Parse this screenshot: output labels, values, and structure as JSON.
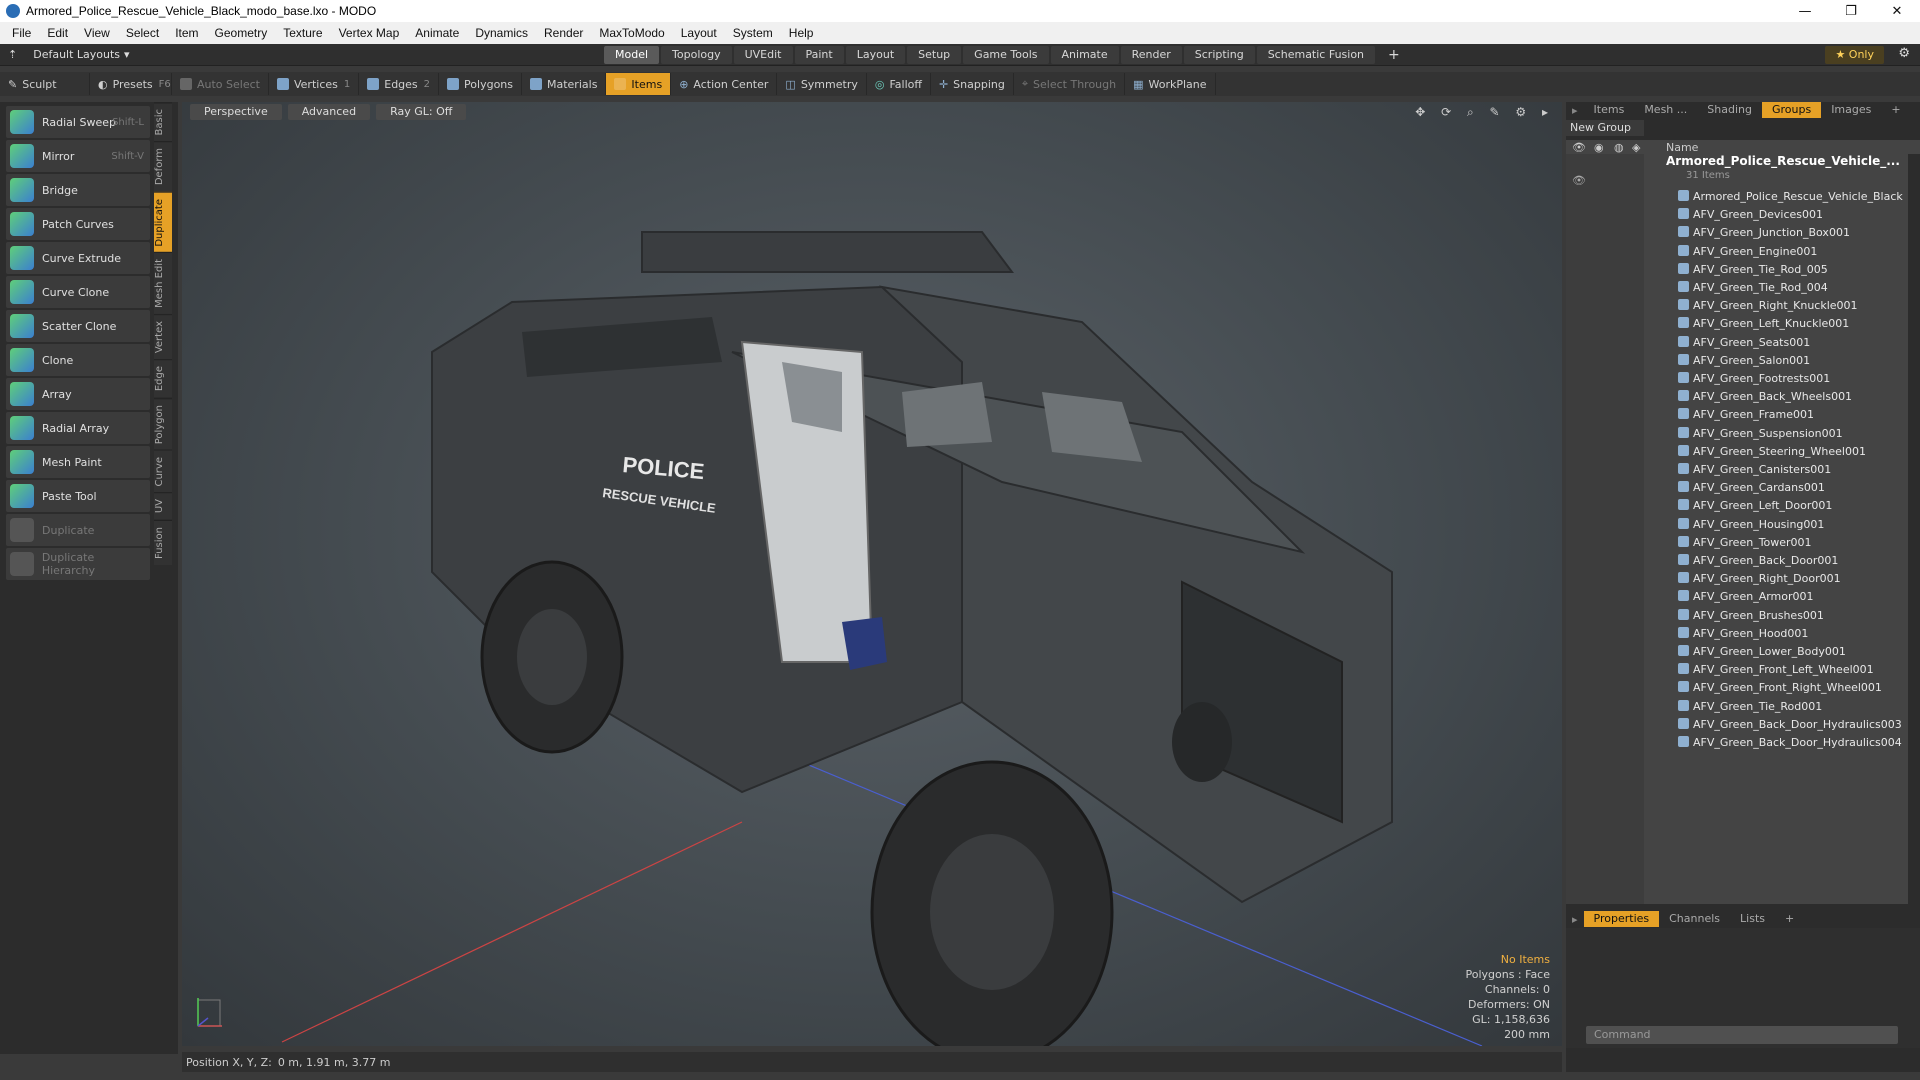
{
  "window": {
    "title": "Armored_Police_Rescue_Vehicle_Black_modo_base.lxo - MODO",
    "min": "—",
    "max": "❐",
    "close": "✕"
  },
  "menubar": [
    "File",
    "Edit",
    "View",
    "Select",
    "Item",
    "Geometry",
    "Texture",
    "Vertex Map",
    "Animate",
    "Dynamics",
    "Render",
    "MaxToModo",
    "Layout",
    "System",
    "Help"
  ],
  "layoutbar": {
    "layouts_label": "Default Layouts",
    "tabs": [
      "Model",
      "Topology",
      "UVEdit",
      "Paint",
      "Layout",
      "Setup",
      "Game Tools",
      "Animate",
      "Render",
      "Scripting",
      "Schematic Fusion"
    ],
    "active_tab": "Model",
    "add": "+",
    "only": "★ Only"
  },
  "toolbar": {
    "sculpt": "Sculpt",
    "presets": "Presets",
    "presets_key": "F6",
    "auto_select": "Auto Select",
    "vertices": "Vertices",
    "vertices_num": "1",
    "edges": "Edges",
    "edges_num": "2",
    "polygons": "Polygons",
    "materials": "Materials",
    "items": "Items",
    "action_center": "Action Center",
    "symmetry": "Symmetry",
    "falloff": "Falloff",
    "snapping": "Snapping",
    "select_through": "Select Through",
    "workplane": "WorkPlane"
  },
  "tools": [
    {
      "label": "Radial Sweep",
      "shortcut": "Shift-L",
      "enabled": true
    },
    {
      "label": "Mirror",
      "shortcut": "Shift-V",
      "enabled": true
    },
    {
      "label": "Bridge",
      "shortcut": "",
      "enabled": true
    },
    {
      "label": "Patch Curves",
      "shortcut": "",
      "enabled": true
    },
    {
      "label": "Curve Extrude",
      "shortcut": "",
      "enabled": true
    },
    {
      "label": "Curve Clone",
      "shortcut": "",
      "enabled": true
    },
    {
      "label": "Scatter Clone",
      "shortcut": "",
      "enabled": true
    },
    {
      "label": "Clone",
      "shortcut": "",
      "enabled": true
    },
    {
      "label": "Array",
      "shortcut": "",
      "enabled": true
    },
    {
      "label": "Radial Array",
      "shortcut": "",
      "enabled": true
    },
    {
      "label": "Mesh Paint",
      "shortcut": "",
      "enabled": true
    },
    {
      "label": "Paste Tool",
      "shortcut": "",
      "enabled": true
    },
    {
      "label": "Duplicate",
      "shortcut": "",
      "enabled": false
    },
    {
      "label": "Duplicate Hierarchy",
      "shortcut": "",
      "enabled": false
    }
  ],
  "vtabs": [
    "Basic",
    "Deform",
    "Duplicate",
    "Mesh Edit",
    "Vertex",
    "Edge",
    "Polygon",
    "Curve",
    "UV",
    "Fusion"
  ],
  "active_vtab": "Duplicate",
  "viewport": {
    "buttons": [
      "Perspective",
      "Advanced",
      "Ray GL: Off"
    ],
    "icons": "✥ ⟳ ⌕ ✎ ⚙ ▸",
    "info": {
      "no_items": "No Items",
      "polygons": "Polygons : Face",
      "channels": "Channels: 0",
      "deformers": "Deformers: ON",
      "gl": "GL: 1,158,636",
      "scale": "200 mm"
    },
    "decal_line1": "POLICE",
    "decal_line2": "RESCUE VEHICLE"
  },
  "statusbar": {
    "label": "Position X, Y, Z:",
    "value": "0 m, 1.91 m, 3.77 m"
  },
  "rightpanel": {
    "tabs": [
      "Items",
      "Mesh ...",
      "Shading",
      "Groups",
      "Images"
    ],
    "active_tab": "Groups",
    "add": "+",
    "new_group": "New Group",
    "name_header": "Name",
    "group_title": "Armored_Police_Rescue_Vehicle_...",
    "group_count": "31 Items",
    "items": [
      "Armored_Police_Rescue_Vehicle_Black",
      "AFV_Green_Devices001",
      "AFV_Green_Junction_Box001",
      "AFV_Green_Engine001",
      "AFV_Green_Tie_Rod_005",
      "AFV_Green_Tie_Rod_004",
      "AFV_Green_Right_Knuckle001",
      "AFV_Green_Left_Knuckle001",
      "AFV_Green_Seats001",
      "AFV_Green_Salon001",
      "AFV_Green_Footrests001",
      "AFV_Green_Back_Wheels001",
      "AFV_Green_Frame001",
      "AFV_Green_Suspension001",
      "AFV_Green_Steering_Wheel001",
      "AFV_Green_Canisters001",
      "AFV_Green_Cardans001",
      "AFV_Green_Left_Door001",
      "AFV_Green_Housing001",
      "AFV_Green_Tower001",
      "AFV_Green_Back_Door001",
      "AFV_Green_Right_Door001",
      "AFV_Green_Armor001",
      "AFV_Green_Brushes001",
      "AFV_Green_Hood001",
      "AFV_Green_Lower_Body001",
      "AFV_Green_Front_Left_Wheel001",
      "AFV_Green_Front_Right_Wheel001",
      "AFV_Green_Tie_Rod001",
      "AFV_Green_Back_Door_Hydraulics003",
      "AFV_Green_Back_Door_Hydraulics004"
    ],
    "bottom_tabs": [
      "Properties",
      "Channels",
      "Lists"
    ],
    "active_bottom_tab": "Properties",
    "command_placeholder": "Command"
  },
  "colors": {
    "accent": "#e6a126",
    "viewport_bg": "#4a5156",
    "panel_bg": "#2c2c2c"
  }
}
